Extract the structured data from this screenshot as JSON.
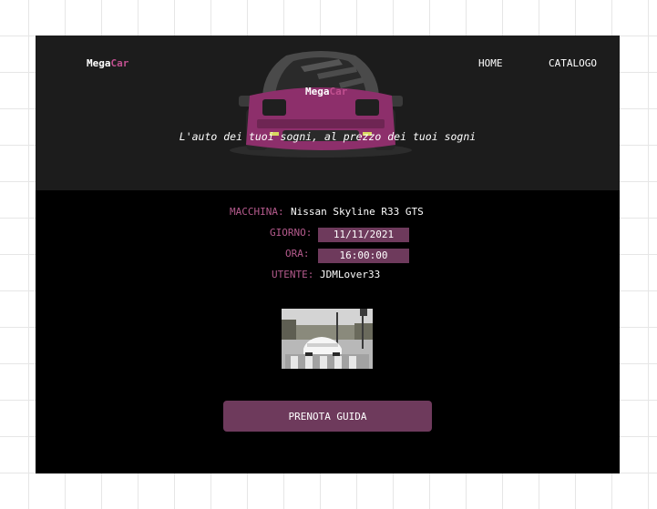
{
  "brand": {
    "prefix": "Mega",
    "suffix": "Car",
    "accent_color": "#c0508f"
  },
  "nav": {
    "home": "HOME",
    "catalog": "CATALOGO"
  },
  "header": {
    "tagline": "L'auto dei tuoi sogni, al prezzo dei tuoi sogni"
  },
  "booking": {
    "car_label": "MACCHINA:",
    "car_value": "Nissan Skyline R33 GTS",
    "day_label": "GIORNO:",
    "day_value": "11/11/2021",
    "time_label": "ORA:",
    "time_value": "16:00:00",
    "user_label": "UTENTE:",
    "user_value": "JDMLover33"
  },
  "cta": {
    "label": "PRENOTA GUIDA",
    "color": "#6e3a5c"
  },
  "images": {
    "header_icon": "car-front-icon",
    "thumbnail": "car-photo"
  }
}
